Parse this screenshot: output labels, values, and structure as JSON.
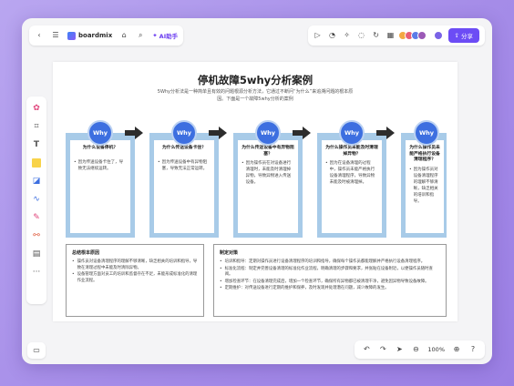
{
  "app": {
    "name": "boardmix",
    "ai_label": "AI助手",
    "share_label": "分享",
    "zoom": "100%"
  },
  "colors": {
    "accent": "#6c4cf5",
    "why_circle": "#3d6fe0",
    "column_bg": "#a8cbe8"
  },
  "doc": {
    "title": "停机故障5why分析案例",
    "intro": "5Why分析法是一种简单且有效的问题根源分析方法，它通过不断问“为什么”来追溯问题的根本原因。下面是一个故障5why分析的案例",
    "why_label": "Why",
    "columns": [
      {
        "question": "为什么设备停机？",
        "answer": "因为传送设备卡住了，导致无法继续运转。"
      },
      {
        "question": "为什么传送设备卡住？",
        "answer": "因为传送设备中有异物阻塞，导致无法正常运转。"
      },
      {
        "question": "为什么传送设备中有异物阻塞？",
        "answer": "因为操作员在对设备进行清理时，未能及时清理掉异物，导致异物进入传送设备。"
      },
      {
        "question": "为什么操作员未能及时清理掉异物？",
        "answer": "因为在设备清理的过程中，操作员未能严格执行设备清理程序，导致异物未能及时被清理掉。"
      },
      {
        "question": "为什么操作员未能严格执行设备清理程序？",
        "answer": "因为操作员对设备清理程序的理解不够清晰，缺乏相关的培训和指导。"
      }
    ],
    "root_cause": {
      "heading": "总结根本原因",
      "items": [
        "操作员对设备清理程序的理解不够清晰，缺乏相关的培训和指导，导致在清理过程中未能及时清除异物。",
        "设备管理方面对员工的培训和监督存在不足，未能形成标准化的清理作业流程。"
      ]
    },
    "countermeasures": {
      "heading": "制定对策",
      "items": [
        "培训和指导：定期对操作员进行设备清理程序的培训和指导，确保每个操作员都能理解并严格执行设备清理程序。",
        "标准化流程：制定并完善设备清理的标准化作业流程，明确清理的步骤和要求，并张贴在设备附近，以便操作员随时查阅。",
        "增加检查环节：在设备清理完成后，增加一个检查环节，确保所有异物都已被清理干净，避免因异物导致设备故障。",
        "定期维护：对传送设备进行定期的维护和保养，及时发现并处理潜在问题，减少故障的发生。"
      ]
    }
  }
}
